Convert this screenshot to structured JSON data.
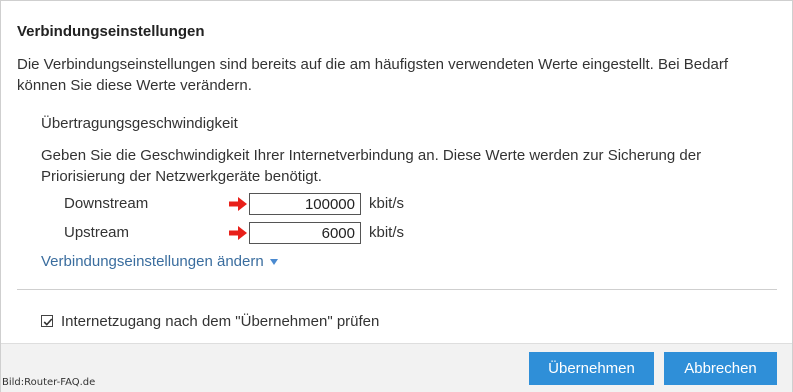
{
  "section": {
    "title": "Verbindungseinstellungen",
    "intro": "Die Verbindungseinstellungen sind bereits auf die am häufigsten verwendeten Werte eingestellt. Bei Bedarf können Sie diese Werte verändern."
  },
  "speed": {
    "title": "Übertragungsgeschwindigkeit",
    "description": "Geben Sie die Geschwindigkeit Ihrer Internetverbindung an. Diese Werte werden zur Sicherung der Priorisierung der Netzwerkgeräte benötigt.",
    "downstream": {
      "label": "Downstream",
      "value": "100000",
      "unit": "kbit/s"
    },
    "upstream": {
      "label": "Upstream",
      "value": "6000",
      "unit": "kbit/s"
    },
    "arrow_color": "#e8201a",
    "arrow_icon": "right-arrow-icon"
  },
  "link": {
    "label": "Verbindungseinstellungen ändern",
    "icon": "caret-down-icon"
  },
  "check": {
    "label": "Internetzugang nach dem \"Übernehmen\" prüfen",
    "checked": true
  },
  "buttons": {
    "apply": "Übernehmen",
    "cancel": "Abbrechen",
    "color": "#2f8fd8"
  },
  "watermark": "Bild:Router-FAQ.de"
}
